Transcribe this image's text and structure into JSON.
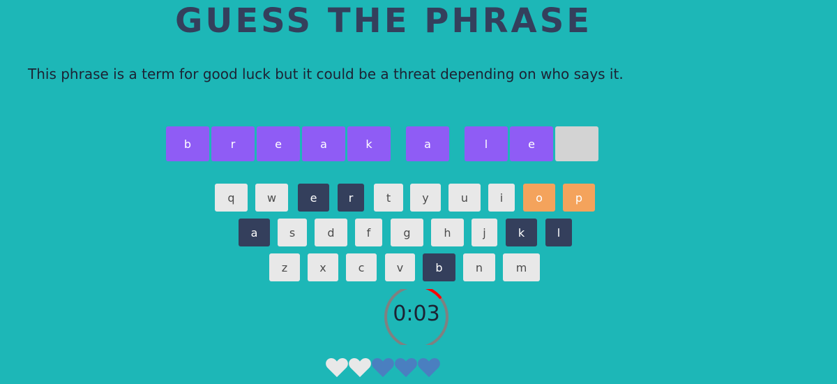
{
  "title": "GUESS THE PHRASE",
  "hint": "This phrase is a term for good luck but it could be a threat depending on who says it.",
  "phrase": {
    "tiles": [
      {
        "letter": "b",
        "state": "revealed"
      },
      {
        "letter": "r",
        "state": "revealed"
      },
      {
        "letter": "e",
        "state": "revealed"
      },
      {
        "letter": "a",
        "state": "revealed"
      },
      {
        "letter": "k",
        "state": "revealed"
      },
      {
        "letter": "a",
        "state": "revealed"
      },
      {
        "letter": "l",
        "state": "revealed"
      },
      {
        "letter": "e",
        "state": "revealed"
      },
      {
        "letter": "",
        "state": "hidden"
      }
    ]
  },
  "keyboard": {
    "rows": [
      [
        {
          "key": "q",
          "state": "unused"
        },
        {
          "key": "w",
          "state": "unused"
        },
        {
          "key": "e",
          "state": "used"
        },
        {
          "key": "r",
          "state": "used"
        },
        {
          "key": "t",
          "state": "unused"
        },
        {
          "key": "y",
          "state": "unused"
        },
        {
          "key": "u",
          "state": "unused"
        },
        {
          "key": "i",
          "state": "unused"
        },
        {
          "key": "o",
          "state": "wrong"
        },
        {
          "key": "p",
          "state": "wrong"
        }
      ],
      [
        {
          "key": "a",
          "state": "used"
        },
        {
          "key": "s",
          "state": "unused"
        },
        {
          "key": "d",
          "state": "unused"
        },
        {
          "key": "f",
          "state": "unused"
        },
        {
          "key": "g",
          "state": "unused"
        },
        {
          "key": "h",
          "state": "unused"
        },
        {
          "key": "j",
          "state": "unused"
        },
        {
          "key": "k",
          "state": "used"
        },
        {
          "key": "l",
          "state": "used"
        }
      ],
      [
        {
          "key": "z",
          "state": "unused"
        },
        {
          "key": "x",
          "state": "unused"
        },
        {
          "key": "c",
          "state": "unused"
        },
        {
          "key": "v",
          "state": "unused"
        },
        {
          "key": "b",
          "state": "used"
        },
        {
          "key": "n",
          "state": "unused"
        },
        {
          "key": "m",
          "state": "unused"
        }
      ]
    ]
  },
  "timer": {
    "display": "0:03",
    "remaining_fraction": 0.14,
    "ring_color": "#808080",
    "progress_color": "#ff0000"
  },
  "lives": {
    "hearts": [
      {
        "state": "lost",
        "icon": "heart-icon"
      },
      {
        "state": "lost",
        "icon": "heart-icon"
      },
      {
        "state": "remaining",
        "icon": "heart-icon"
      },
      {
        "state": "remaining",
        "icon": "heart-icon"
      },
      {
        "state": "remaining",
        "icon": "heart-icon"
      }
    ],
    "lost_color": "#e8e8e8",
    "remaining_color": "#4a7fc0"
  },
  "colors": {
    "background": "#1db7b7",
    "title": "#343f5c",
    "tile_revealed": "#8f5cf5",
    "tile_hidden": "#d3d3d3",
    "key_unused": "#e8e8e8",
    "key_used": "#343f5c",
    "key_wrong": "#f4a35c"
  }
}
